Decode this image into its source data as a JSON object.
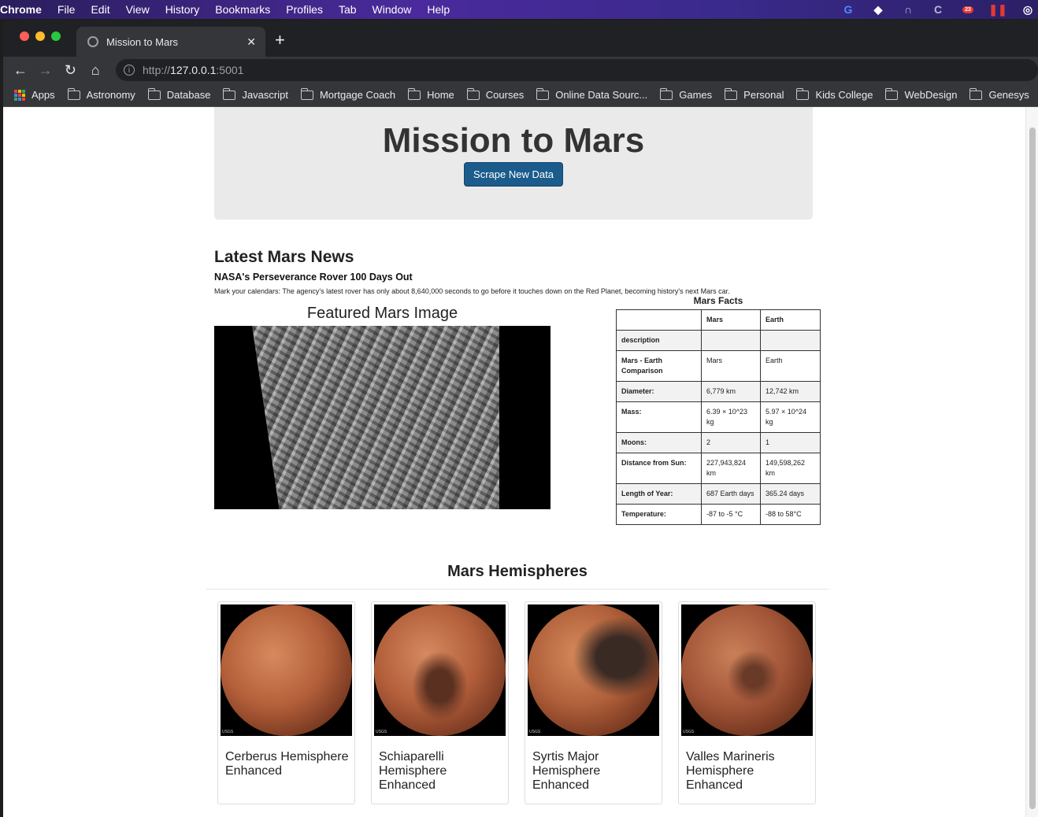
{
  "menubar": {
    "app": "Chrome",
    "items": [
      "File",
      "Edit",
      "View",
      "History",
      "Bookmarks",
      "Profiles",
      "Tab",
      "Window",
      "Help"
    ],
    "badge": "23"
  },
  "browser": {
    "tab_title": "Mission to Mars",
    "url_scheme": "http://",
    "url_host": "127.0.0.1",
    "url_port": ":5001",
    "bookmarks": [
      "Apps",
      "Astronomy",
      "Database",
      "Javascript",
      "Mortgage Coach",
      "Home",
      "Courses",
      "Online Data Sourc...",
      "Games",
      "Personal",
      "Kids College",
      "WebDesign",
      "Genesys"
    ]
  },
  "page": {
    "title": "Mission to Mars",
    "scrape_button": "Scrape New Data",
    "news": {
      "heading": "Latest Mars News",
      "title": "NASA's Perseverance Rover 100 Days Out",
      "paragraph": "Mark your calendars: The agency's latest rover has only about 8,640,000 seconds to go before it touches down on the Red Planet, becoming history's next Mars car."
    },
    "featured_heading": "Featured Mars Image",
    "facts": {
      "caption": "Mars Facts",
      "headers": [
        "",
        "Mars",
        "Earth"
      ],
      "rows": [
        [
          "description",
          "",
          ""
        ],
        [
          "Mars - Earth Comparison",
          "Mars",
          "Earth"
        ],
        [
          "Diameter:",
          "6,779 km",
          "12,742 km"
        ],
        [
          "Mass:",
          "6.39 × 10^23 kg",
          "5.97 × 10^24 kg"
        ],
        [
          "Moons:",
          "2",
          "1"
        ],
        [
          "Distance from Sun:",
          "227,943,824 km",
          "149,598,262 km"
        ],
        [
          "Length of Year:",
          "687 Earth days",
          "365.24 days"
        ],
        [
          "Temperature:",
          "-87 to -5 °C",
          "-88 to 58°C"
        ]
      ]
    },
    "hemispheres": {
      "heading": "Mars Hemispheres",
      "items": [
        {
          "title": "Cerberus Hemisphere Enhanced"
        },
        {
          "title": "Schiaparelli Hemisphere Enhanced"
        },
        {
          "title": "Syrtis Major Hemisphere Enhanced"
        },
        {
          "title": "Valles Marineris Hemisphere Enhanced"
        }
      ],
      "image_credit": "USGS"
    }
  }
}
